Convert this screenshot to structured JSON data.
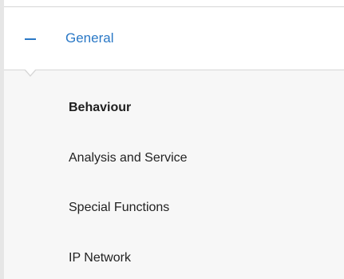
{
  "section": {
    "title": "General",
    "expanded": true,
    "icon": "minus-icon",
    "accent_color": "#2a78c6"
  },
  "submenu": {
    "items": [
      {
        "label": "Behaviour",
        "active": true
      },
      {
        "label": "Analysis and Service",
        "active": false
      },
      {
        "label": "Special Functions",
        "active": false
      },
      {
        "label": "IP Network",
        "active": false
      }
    ]
  }
}
